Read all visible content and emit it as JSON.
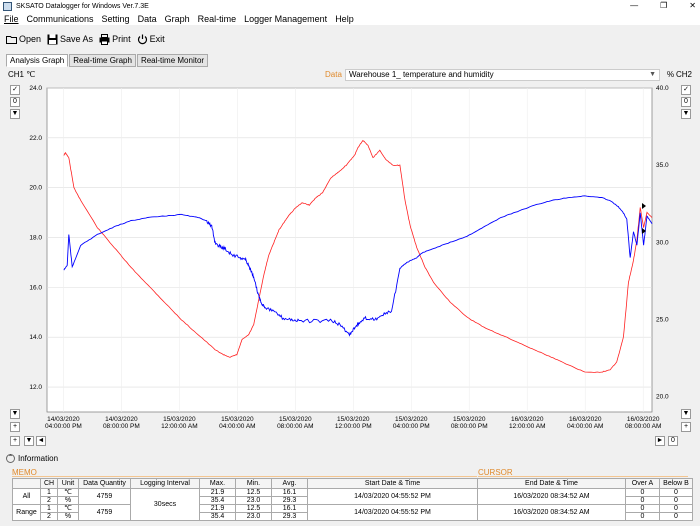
{
  "window": {
    "title": "SKSATO Datalogger for Windows  Ver.7.3E",
    "min": "—",
    "max": "❐",
    "close": "✕"
  },
  "menu": [
    "File",
    "Communications",
    "Setting",
    "Data",
    "Graph",
    "Real-time",
    "Logger Management",
    "Help"
  ],
  "toolbar": {
    "open": "Open",
    "save_as": "Save As",
    "print": "Print",
    "exit": "Exit"
  },
  "tabs": [
    "Analysis Graph",
    "Real-time Graph",
    "Real-time Monitor"
  ],
  "header": {
    "ch1": "CH1 ℃",
    "ch2": "CH2",
    "data_label": "Data",
    "data_select": "Warehouse 1_ temperature and humidity",
    "pct": "%"
  },
  "controls": {
    "check": "✓",
    "zero": "0",
    "down": "▼",
    "plus": "+",
    "left": "◄",
    "right": "►"
  },
  "chart_data": {
    "type": "line",
    "y_left": {
      "ticks": [
        "24.0",
        "22.0",
        "20.0",
        "18.0",
        "16.0",
        "14.0",
        "12.0"
      ],
      "min": 11.0,
      "max": 24.0
    },
    "y_right": {
      "ticks": [
        "40.0",
        "35.0",
        "30.0",
        "25.0",
        "20.0"
      ],
      "min": 19.0,
      "max": 40.0
    },
    "x_ticks": [
      [
        "14/03/2020",
        "04:00:00 PM"
      ],
      [
        "14/03/2020",
        "08:00:00 PM"
      ],
      [
        "15/03/2020",
        "12:00:00 AM"
      ],
      [
        "15/03/2020",
        "04:00:00 AM"
      ],
      [
        "15/03/2020",
        "08:00:00 AM"
      ],
      [
        "15/03/2020",
        "12:00:00 PM"
      ],
      [
        "15/03/2020",
        "04:00:00 PM"
      ],
      [
        "15/03/2020",
        "08:00:00 PM"
      ],
      [
        "16/03/2020",
        "12:00:00 AM"
      ],
      [
        "16/03/2020",
        "04:00:00 AM"
      ],
      [
        "16/03/2020",
        "08:00:00 AM"
      ]
    ],
    "series": [
      {
        "axis": "left",
        "unit": "℃",
        "color": "#ff2020",
        "t": [
          1.0,
          1.1,
          1.3,
          1.6,
          2.0,
          3.0,
          4.0,
          5.0,
          6.0,
          7.0,
          8.0,
          9.0,
          10.0,
          10.5,
          10.9,
          11.3,
          11.6,
          12.0,
          12.3,
          12.6,
          12.9,
          13.2,
          13.5,
          13.8,
          14.1,
          14.4,
          14.8,
          15.2,
          15.6,
          16.0,
          16.4,
          16.9,
          17.3,
          17.8,
          18.3,
          18.5,
          18.8,
          19.1,
          19.4,
          19.8,
          20.2,
          20.6,
          21.0,
          21.3,
          21.6,
          22.0,
          22.5,
          23.0,
          24.0,
          25.0,
          26.0,
          27.0,
          28.0,
          29.0,
          30.0,
          31.0,
          32.0,
          33.0,
          33.5,
          33.9,
          34.3,
          34.6,
          34.9,
          35.1,
          35.3,
          35.5,
          35.7,
          36.0
        ],
        "v": [
          21.3,
          21.4,
          21.2,
          20.0,
          19.5,
          18.4,
          17.6,
          16.8,
          16.1,
          15.4,
          14.7,
          14.1,
          13.5,
          13.3,
          13.2,
          13.3,
          13.9,
          14.1,
          14.5,
          15.5,
          16.5,
          17.3,
          17.8,
          18.3,
          18.6,
          18.9,
          19.2,
          19.4,
          19.3,
          19.6,
          19.8,
          20.4,
          20.6,
          20.9,
          21.3,
          21.6,
          21.9,
          21.7,
          21.2,
          21.5,
          21.1,
          20.9,
          20.9,
          19.5,
          18.5,
          17.6,
          16.8,
          16.2,
          15.4,
          14.8,
          14.4,
          14.1,
          13.8,
          13.5,
          13.2,
          12.9,
          12.6,
          12.6,
          12.7,
          13.0,
          14.0,
          16.2,
          17.1,
          17.9,
          19.2,
          18.4,
          19.0,
          18.8
        ]
      },
      {
        "axis": "right",
        "unit": "%",
        "color": "#0000ff",
        "t": [
          1.0,
          1.2,
          1.3,
          1.5,
          2.0,
          3.0,
          4.0,
          5.0,
          6.0,
          7.0,
          8.0,
          9.0,
          9.5,
          9.8,
          10.0,
          10.3,
          10.6,
          11.0,
          11.5,
          11.8,
          12.0,
          12.2,
          12.4,
          12.6,
          12.8,
          13.0,
          13.5,
          14.0,
          14.5,
          15.0,
          16.0,
          17.0,
          17.5,
          18.0,
          18.3,
          18.6,
          19.0,
          19.5,
          20.0,
          20.5,
          21.0,
          21.3,
          21.6,
          22.0,
          22.3,
          23.0,
          24.0,
          25.0,
          26.0,
          27.0,
          28.0,
          29.0,
          30.0,
          31.0,
          32.0,
          33.0,
          33.5,
          34.0,
          34.3,
          34.5,
          34.7,
          34.9,
          35.1,
          35.3,
          35.5,
          35.7,
          36.0
        ],
        "v": [
          28.2,
          28.5,
          30.5,
          28.4,
          29.8,
          30.5,
          31.0,
          31.4,
          31.6,
          31.7,
          31.8,
          31.6,
          31.4,
          31.0,
          30.0,
          29.7,
          29.6,
          29.2,
          29.0,
          28.9,
          28.5,
          28.0,
          27.3,
          26.5,
          26.0,
          25.8,
          25.5,
          25.1,
          25.0,
          24.9,
          24.9,
          24.9,
          24.6,
          24.0,
          24.5,
          24.8,
          25.1,
          25.0,
          25.3,
          25.5,
          28.3,
          28.6,
          28.8,
          29.0,
          29.3,
          29.6,
          30.0,
          30.4,
          31.0,
          31.6,
          32.0,
          32.4,
          32.7,
          32.9,
          33.0,
          32.9,
          32.7,
          32.3,
          31.9,
          31.5,
          29.0,
          30.7,
          29.8,
          31.9,
          29.8,
          31.7,
          31.2
        ]
      }
    ]
  },
  "info": {
    "header": "Information",
    "memo": "MEMO",
    "cursor": "CURSOR",
    "columns": [
      "CH",
      "Unit",
      "Data Quantity",
      "Logging Interval",
      "Max.",
      "Min.",
      "Avg.",
      "Start Date & Time",
      "End Date & Time",
      "Over A",
      "Below B"
    ],
    "groups": [
      {
        "label": "All",
        "quantity": "4759",
        "interval": "30secs",
        "start": "14/03/2020 04:55:52 PM",
        "end": "16/03/2020 08:34:52 AM",
        "rows": [
          {
            "ch": "1",
            "unit": "℃",
            "max": "21.9",
            "min": "12.5",
            "avg": "16.1",
            "over": "0",
            "below": "0"
          },
          {
            "ch": "2",
            "unit": "%",
            "max": "35.4",
            "min": "23.0",
            "avg": "29.3",
            "over": "0",
            "below": "0"
          }
        ]
      },
      {
        "label": "Range",
        "quantity": "4759",
        "start": "14/03/2020 04:55:52 PM",
        "end": "16/03/2020 08:34:52 AM",
        "rows": [
          {
            "ch": "1",
            "unit": "℃",
            "max": "21.9",
            "min": "12.5",
            "avg": "16.1",
            "over": "0",
            "below": "0"
          },
          {
            "ch": "2",
            "unit": "%",
            "max": "35.4",
            "min": "23.0",
            "avg": "29.3",
            "over": "0",
            "below": "0"
          }
        ]
      }
    ]
  }
}
